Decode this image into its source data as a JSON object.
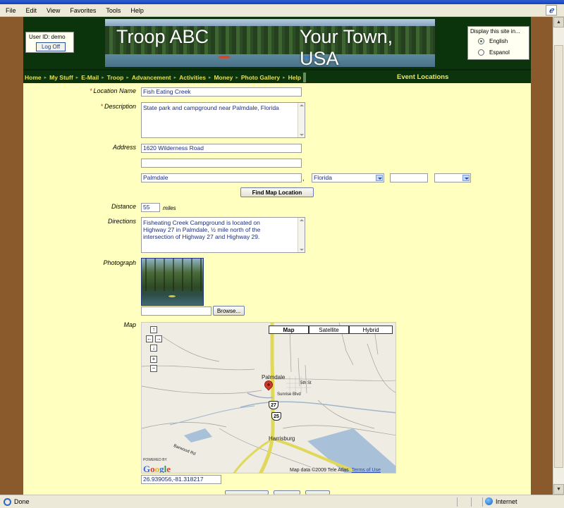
{
  "browser": {
    "menu": [
      "File",
      "Edit",
      "View",
      "Favorites",
      "Tools",
      "Help"
    ],
    "status": "Done",
    "zone": "Internet",
    "logo": "windows-xp-icon"
  },
  "header": {
    "user_id": "User ID:  demo",
    "logoff": "Log Off",
    "banner_title_left": "Troop ABC",
    "banner_title_right": "Your Town, USA",
    "language_title": "Display this site in...",
    "languages": [
      "English",
      "Espanol"
    ],
    "language_selected": "English"
  },
  "nav": {
    "items": [
      "Home",
      "My Stuff",
      "E-Mail",
      "Troop",
      "Advancement",
      "Activities",
      "Money",
      "Photo Gallery",
      "Help"
    ],
    "page_title": "Event Locations"
  },
  "form": {
    "location_name_label": "Location Name",
    "location_name": "Fish Eating Creek",
    "description_label": "Description",
    "description": "State park and campground near Palmdale, Florida",
    "address_label": "Address",
    "address1": "1620 Wilderness Road",
    "address2": "",
    "city": "Palmdale",
    "state": "Florida",
    "zip": "",
    "country": "",
    "find_map_button": "Find Map Location",
    "distance_label": "Distance",
    "distance": "55",
    "distance_unit": "miles",
    "directions_label": "Directions",
    "directions": "Fisheating Creek Campground is located on Highway 27 in Palmdale, ½ mile north of the intersection of Highway 27 and Highway 29.",
    "photograph_label": "Photograph",
    "browse_button": "Browse...",
    "map_label": "Map",
    "coordinates": "26.939056,-81.318217"
  },
  "map": {
    "types": [
      "Map",
      "Satellite",
      "Hybrid"
    ],
    "type_selected": "Map",
    "controls": [
      "↑",
      "←",
      "→",
      "↓",
      "+",
      "−"
    ],
    "labels": {
      "palmdale": "Palmdale",
      "fifth_st": "5th St",
      "sunrise": "Sunrise Blvd",
      "harrisburg": "Harrisburg",
      "barwood": "Barwood Rd"
    },
    "shields": [
      "27",
      "25"
    ],
    "powered_by": "POWERED BY",
    "google": "Google",
    "attribution": "Map data ©2009 Tele Atlas",
    "terms": "Terms of Use"
  }
}
